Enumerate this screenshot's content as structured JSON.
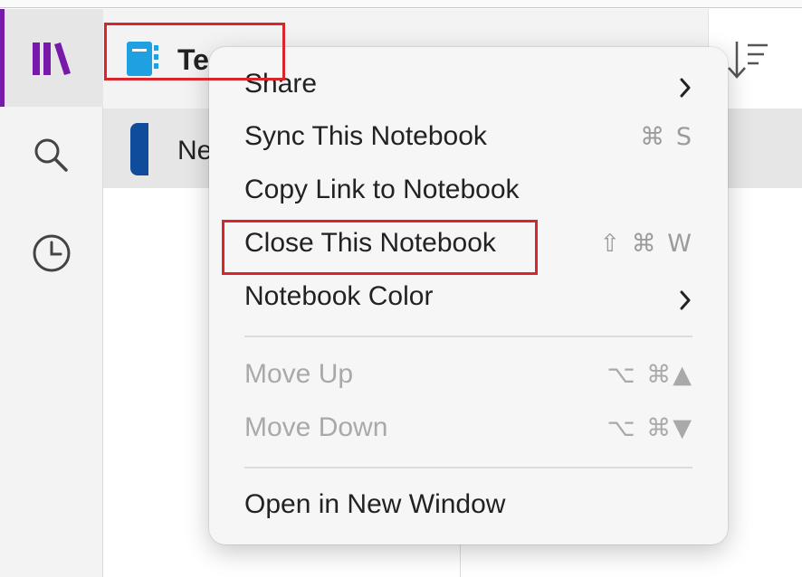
{
  "header": {
    "notebook_title": "Te"
  },
  "section": {
    "label": "Ne"
  },
  "rail": {
    "items": [
      {
        "name": "notebooks",
        "icon": "library-icon",
        "active": true
      },
      {
        "name": "search",
        "icon": "search-icon"
      },
      {
        "name": "recent",
        "icon": "clock-icon"
      }
    ]
  },
  "context_menu": {
    "items": [
      {
        "label": "Share",
        "submenu": true
      },
      {
        "label": "Sync This Notebook",
        "shortcut": "⌘ S"
      },
      {
        "label": "Copy Link to Notebook"
      },
      {
        "label": "Close This Notebook",
        "shortcut": "⇧ ⌘ W"
      },
      {
        "label": "Notebook Color",
        "submenu": true
      },
      {
        "label": "Move Up",
        "shortcut": "⌥ ⌘▲",
        "disabled": true
      },
      {
        "label": "Move Down",
        "shortcut": "⌥ ⌘▼",
        "disabled": true
      },
      {
        "label": "Open in New Window"
      }
    ]
  },
  "colors": {
    "accent": "#7719aa",
    "notebook_icon": "#1fa0e0",
    "section_tab": "#0f4c9c",
    "highlight": "#d9262c"
  }
}
